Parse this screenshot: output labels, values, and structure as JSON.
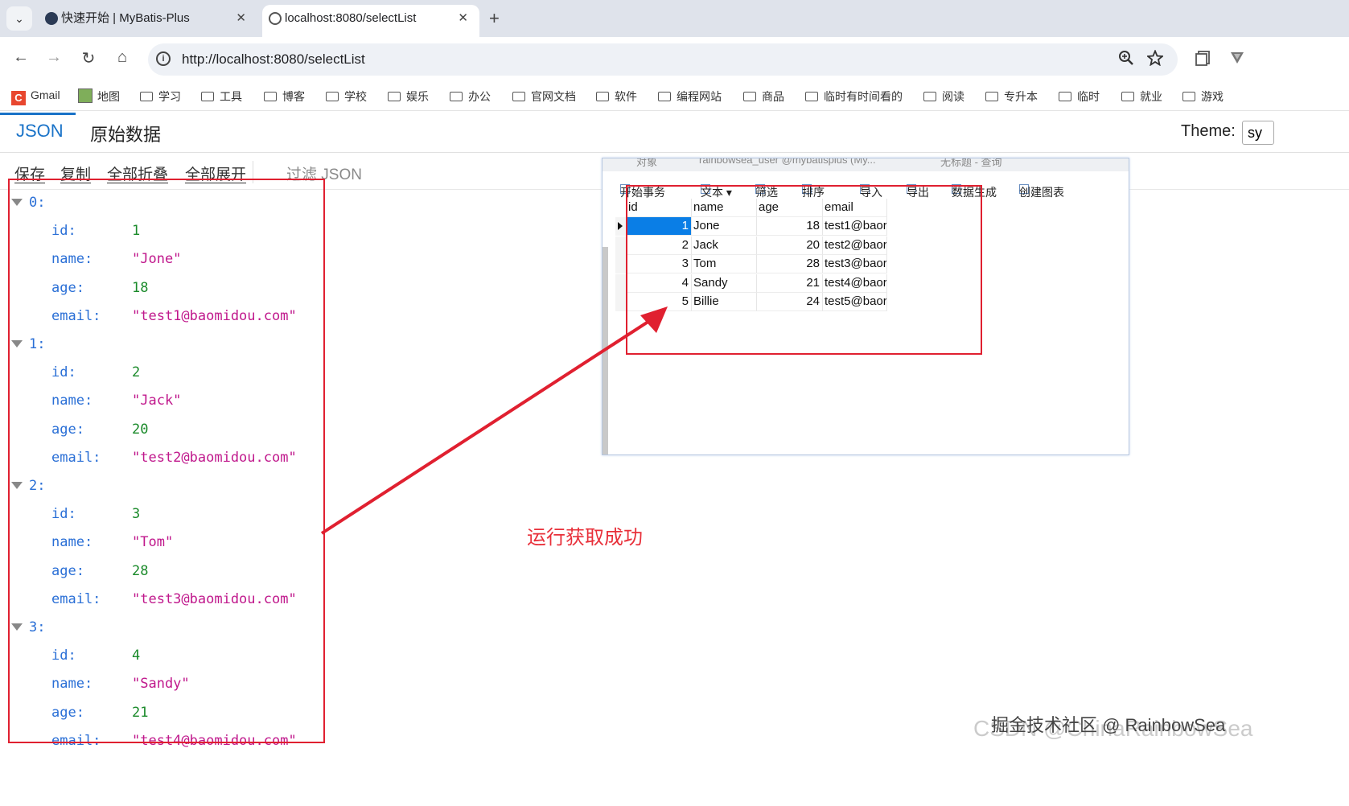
{
  "browser": {
    "tabs": [
      {
        "label": "快速开始 | MyBatis-Plus",
        "close": "✕"
      },
      {
        "label": "localhost:8080/selectList",
        "close": "✕"
      }
    ],
    "new_tab": "+",
    "tab_search": "⌄",
    "url": "http://localhost:8080/selectList",
    "nav": {
      "back": "←",
      "forward": "→",
      "reload": "↻",
      "home": "⌂"
    },
    "omnibox_icons": {
      "zoom": "zoom-icon",
      "star": "star-icon"
    },
    "bookmarks": [
      {
        "label": "Gmail",
        "icon": "gmail-icon"
      },
      {
        "label": "地图",
        "icon": "map-icon"
      },
      {
        "label": "学习",
        "icon": "folder-icon"
      },
      {
        "label": "工具",
        "icon": "folder-icon"
      },
      {
        "label": "博客",
        "icon": "folder-icon"
      },
      {
        "label": "学校",
        "icon": "folder-icon"
      },
      {
        "label": "娱乐",
        "icon": "folder-icon"
      },
      {
        "label": "办公",
        "icon": "folder-icon"
      },
      {
        "label": "官网文档",
        "icon": "folder-icon"
      },
      {
        "label": "软件",
        "icon": "folder-icon"
      },
      {
        "label": "编程网站",
        "icon": "folder-icon"
      },
      {
        "label": "商品",
        "icon": "folder-icon"
      },
      {
        "label": "临时有时间看的",
        "icon": "folder-icon"
      },
      {
        "label": "阅读",
        "icon": "folder-icon"
      },
      {
        "label": "专升本",
        "icon": "folder-icon"
      },
      {
        "label": "临时",
        "icon": "folder-icon"
      },
      {
        "label": "就业",
        "icon": "folder-icon"
      },
      {
        "label": "游戏",
        "icon": "folder-icon"
      }
    ]
  },
  "viewer": {
    "tabs": {
      "json": "JSON",
      "raw": "原始数据"
    },
    "theme_label": "Theme:",
    "theme_value": "sy",
    "toolbar": {
      "save": "保存",
      "copy": "复制",
      "collapse_all": "全部折叠",
      "expand_all": "全部展开",
      "filter_placeholder": "过滤 JSON"
    }
  },
  "json_tree": [
    {
      "index": "0:",
      "id": "1",
      "name": "\"Jone\"",
      "age": "18",
      "email": "\"test1@baomidou.com\""
    },
    {
      "index": "1:",
      "id": "2",
      "name": "\"Jack\"",
      "age": "20",
      "email": "\"test2@baomidou.com\""
    },
    {
      "index": "2:",
      "id": "3",
      "name": "\"Tom\"",
      "age": "28",
      "email": "\"test3@baomidou.com\""
    },
    {
      "index": "3:",
      "id": "4",
      "name": "\"Sandy\"",
      "age": "21",
      "email": "\"test4@baomidou.com\""
    }
  ],
  "json_keys": {
    "id": "id:",
    "name": "name:",
    "age": "age:",
    "email": "email:"
  },
  "navicat": {
    "tab_strip": [
      "对象",
      "rainbowsea_user @mybatisplus (My...",
      "无标题 - 查询"
    ],
    "tools": [
      "开始事务",
      "文本 ▾",
      "筛选",
      "排序",
      "导入",
      "导出",
      "数据生成",
      "创建图表"
    ],
    "columns": [
      "id",
      "name",
      "age",
      "email"
    ],
    "rows": [
      [
        "1",
        "Jone",
        "18",
        "test1@baor"
      ],
      [
        "2",
        "Jack",
        "20",
        "test2@baor"
      ],
      [
        "3",
        "Tom",
        "28",
        "test3@baor"
      ],
      [
        "4",
        "Sandy",
        "21",
        "test4@baor"
      ],
      [
        "5",
        "Billie",
        "24",
        "test5@baor"
      ]
    ]
  },
  "annotation": "运行获取成功",
  "watermark_back": "CSDN @ChinaRainbowSea",
  "watermark_front": "掘金技术社区 @ RainbowSea",
  "colors": {
    "accent": "#1a73c8",
    "annotation_red": "#e02030",
    "key_blue": "#2a6fd6",
    "number_green": "#1a8a2a",
    "string_magenta": "#c0188c",
    "selection_blue": "#0a7ee6"
  }
}
